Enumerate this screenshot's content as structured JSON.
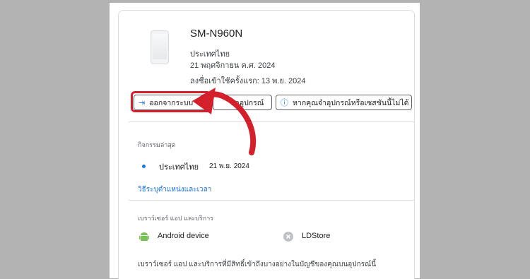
{
  "device": {
    "model": "SM-N960N",
    "country": "ประเทศไทย",
    "date": "21 พฤศจิกายน ค.ศ. 2024",
    "first_signin": "ลงชื่อเข้าใช้ครั้งแรก: 13 พ.ย. 2024"
  },
  "buttons": {
    "signout": "ออกจากระบบ",
    "find": "หาอุปกรณ์",
    "dont_recognize": "หากคุณจำอุปกรณ์หรือเซสชันนี้ไม่ได้"
  },
  "recent_activity": {
    "heading": "กิจกรรมล่าสุด",
    "location": "ประเทศไทย",
    "date": "21 พ.ย. 2024",
    "link": "วิธีระบุตำแหน่งและเวลา"
  },
  "apps": {
    "heading": "เบราว์เซอร์ แอป และบริการ",
    "items": [
      "Android device",
      "LDStore"
    ],
    "note": "เบราว์เซอร์ แอป และบริการที่มีสิทธิ์เข้าถึงบางอย่างในบัญชีของคุณบนอุปกรณ์นี้"
  },
  "colors": {
    "accent": "#1a73e8",
    "highlight": "#d3202a",
    "android": "#78c257"
  }
}
